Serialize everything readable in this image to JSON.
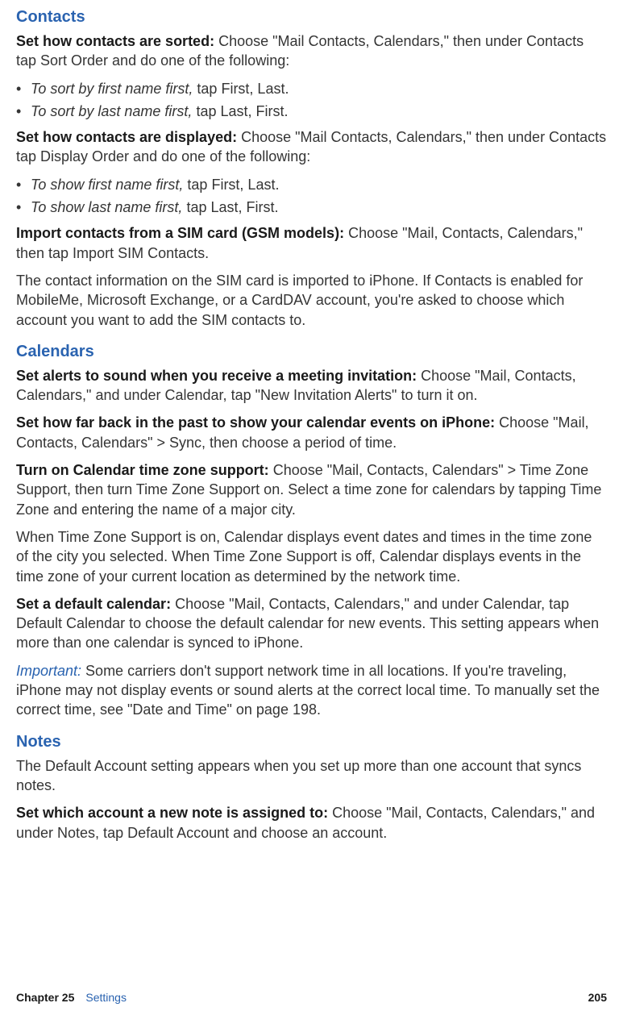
{
  "sections": {
    "contacts": {
      "heading": "Contacts",
      "sort_label": "Set how contacts are sorted:",
      "sort_body": "  Choose \"Mail Contacts, Calendars,\" then under Contacts tap Sort Order and do one of the following:",
      "sort_b1_i": "To sort by first name first,",
      "sort_b1_t": "tap First, Last.",
      "sort_b2_i": "To sort by last name first,",
      "sort_b2_t": "tap Last, First.",
      "display_label": "Set how contacts are displayed:",
      "display_body": "  Choose \"Mail Contacts, Calendars,\" then under Contacts tap Display Order and do one of the following:",
      "display_b1_i": "To show first name first,",
      "display_b1_t": "tap First, Last.",
      "display_b2_i": "To show last name first,",
      "display_b2_t": "tap Last, First.",
      "import_label": "Import contacts from a SIM card (GSM models):",
      "import_body": "  Choose \"Mail, Contacts, Calendars,\" then tap Import SIM Contacts.",
      "import_explain": "The contact information on the SIM card is imported to iPhone. If Contacts is enabled for MobileMe, Microsoft Exchange, or a CardDAV account, you're asked to choose which account you want to add the SIM contacts to."
    },
    "calendars": {
      "heading": "Calendars",
      "alerts_label": "Set alerts to sound when you receive a meeting invitation:",
      "alerts_body": "  Choose \"Mail, Contacts, Calendars,\" and under Calendar, tap \"New Invitation Alerts\" to turn it on.",
      "past_label": "Set how far back in the past to show your calendar events on iPhone:",
      "past_body": "  Choose \"Mail, Contacts, Calendars\" > Sync, then choose a period of time.",
      "tz_label": "Turn on Calendar time zone support:",
      "tz_body": "  Choose \"Mail, Contacts, Calendars\" > Time Zone Support, then turn Time Zone Support on. Select a time zone for calendars by tapping Time Zone and entering the name of a major city.",
      "tz_explain": "When Time Zone Support is on, Calendar displays event dates and times in the time zone of the city you selected. When Time Zone Support is off, Calendar displays events in the time zone of your current location as determined by the network time.",
      "default_label": "Set a default calendar:",
      "default_body": "  Choose \"Mail, Contacts, Calendars,\" and under Calendar, tap Default Calendar to choose the default calendar for new events. This setting appears when more than one calendar is synced to iPhone.",
      "important_label": "Important:",
      "important_body": "  Some carriers don't support network time in all locations. If you're traveling, iPhone may not display events or sound alerts at the correct local time. To manually set the correct time, see \"Date and Time\" on page 198."
    },
    "notes": {
      "heading": "Notes",
      "intro": "The Default Account setting appears when you set up more than one account that syncs notes.",
      "assign_label": "Set which account a new note is assigned to:",
      "assign_body": "  Choose \"Mail, Contacts, Calendars,\" and under Notes, tap Default Account and choose an account."
    }
  },
  "footer": {
    "chapter_num": "Chapter 25",
    "chapter_name": "Settings",
    "page": "205"
  }
}
